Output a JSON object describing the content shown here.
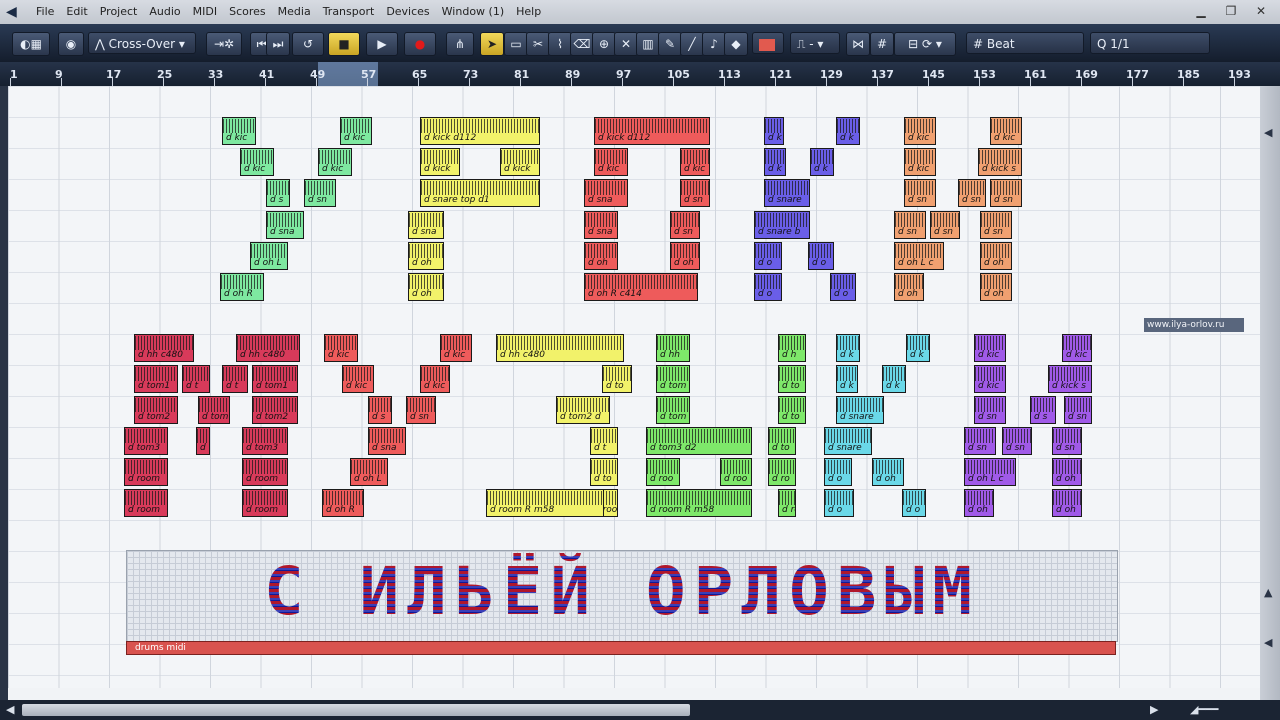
{
  "menubar": {
    "items": [
      "File",
      "Edit",
      "Project",
      "Audio",
      "MIDI",
      "Scores",
      "Media",
      "Transport",
      "Devices",
      "Window (1)",
      "Help"
    ]
  },
  "toolbar": {
    "automation_mode": "Cross-Over",
    "color_swatch": "#e15a4f",
    "snap_type": "Beat",
    "quantize": "1/1"
  },
  "ruler": {
    "ticks": [
      "1",
      "9",
      "17",
      "25",
      "33",
      "41",
      "49",
      "57",
      "65",
      "73",
      "81",
      "89",
      "97",
      "105",
      "113",
      "121",
      "129",
      "137",
      "145",
      "153",
      "161",
      "169",
      "177",
      "185",
      "193"
    ]
  },
  "watermark": "www.ilya-orlov.ru",
  "banner": {
    "title": "С ИЛЬЁЙ ОРЛОВЫМ",
    "track_label": "drums midi"
  },
  "events": [
    {
      "label": "d kic",
      "color": "#7ee8a0"
    },
    {
      "label": "d kic",
      "color": "#7ee8a0"
    },
    {
      "label": "d kic",
      "color": "#7ee8a0"
    },
    {
      "label": "d kic",
      "color": "#7ee8a0"
    },
    {
      "label": "d s",
      "color": "#7ee8a0"
    },
    {
      "label": "d sn",
      "color": "#7ee8a0"
    },
    {
      "label": "d sna",
      "color": "#7ee8a0"
    },
    {
      "label": "d oh L",
      "color": "#7ee8a0"
    },
    {
      "label": "d oh R",
      "color": "#7ee8a0"
    },
    {
      "label": "d kick d112",
      "color": "#f2f26a"
    },
    {
      "label": "d kick",
      "color": "#f2f26a"
    },
    {
      "label": "d kick",
      "color": "#f2f26a"
    },
    {
      "label": "d snare top d1",
      "color": "#f2f26a"
    },
    {
      "label": "d sna",
      "color": "#f2f26a"
    },
    {
      "label": "d oh",
      "color": "#f2f26a"
    },
    {
      "label": "d oh",
      "color": "#f2f26a"
    },
    {
      "label": "d kick d112",
      "color": "#ee5b5b"
    },
    {
      "label": "d kic",
      "color": "#ee5b5b"
    },
    {
      "label": "d kic",
      "color": "#ee5b5b"
    },
    {
      "label": "d sna",
      "color": "#ee5b5b"
    },
    {
      "label": "d sn",
      "color": "#ee5b5b"
    },
    {
      "label": "d sna",
      "color": "#ee5b5b"
    },
    {
      "label": "d sn",
      "color": "#ee5b5b"
    },
    {
      "label": "d oh",
      "color": "#ee5b5b"
    },
    {
      "label": "d oh",
      "color": "#ee5b5b"
    },
    {
      "label": "d oh R c414",
      "color": "#ee5b5b"
    },
    {
      "label": "d k",
      "color": "#6a5ee8"
    },
    {
      "label": "d k",
      "color": "#6a5ee8"
    },
    {
      "label": "d k",
      "color": "#6a5ee8"
    },
    {
      "label": "d k",
      "color": "#6a5ee8"
    },
    {
      "label": "d snare",
      "color": "#6a5ee8"
    },
    {
      "label": "d snare b",
      "color": "#6a5ee8"
    },
    {
      "label": "d o",
      "color": "#6a5ee8"
    },
    {
      "label": "d o",
      "color": "#6a5ee8"
    },
    {
      "label": "d o",
      "color": "#6a5ee8"
    },
    {
      "label": "d o",
      "color": "#6a5ee8"
    },
    {
      "label": "d kic",
      "color": "#f0a070"
    },
    {
      "label": "d kic",
      "color": "#f0a070"
    },
    {
      "label": "d kic",
      "color": "#f0a070"
    },
    {
      "label": "d kick s",
      "color": "#f0a070"
    },
    {
      "label": "d sn",
      "color": "#f0a070"
    },
    {
      "label": "d sn",
      "color": "#f0a070"
    },
    {
      "label": "d sn",
      "color": "#f0a070"
    },
    {
      "label": "d sn",
      "color": "#f0a070"
    },
    {
      "label": "d sn",
      "color": "#f0a070"
    },
    {
      "label": "d sn",
      "color": "#f0a070"
    },
    {
      "label": "d oh L c",
      "color": "#f0a070"
    },
    {
      "label": "d oh",
      "color": "#f0a070"
    },
    {
      "label": "d oh",
      "color": "#f0a070"
    },
    {
      "label": "d oh",
      "color": "#f0a070"
    },
    {
      "label": "d hh c480",
      "color": "#d83a5a"
    },
    {
      "label": "d hh c480",
      "color": "#d83a5a"
    },
    {
      "label": "d tom1",
      "color": "#d83a5a"
    },
    {
      "label": "d t",
      "color": "#d83a5a"
    },
    {
      "label": "d t",
      "color": "#d83a5a"
    },
    {
      "label": "d tom1",
      "color": "#d83a5a"
    },
    {
      "label": "d tom2",
      "color": "#d83a5a"
    },
    {
      "label": "d tom",
      "color": "#d83a5a"
    },
    {
      "label": "d tom2",
      "color": "#d83a5a"
    },
    {
      "label": "d tom3",
      "color": "#d83a5a"
    },
    {
      "label": "d",
      "color": "#d83a5a"
    },
    {
      "label": "d tom3",
      "color": "#d83a5a"
    },
    {
      "label": "d room",
      "color": "#d83a5a"
    },
    {
      "label": "d room",
      "color": "#d83a5a"
    },
    {
      "label": "d room",
      "color": "#d83a5a"
    },
    {
      "label": "d room",
      "color": "#d83a5a"
    },
    {
      "label": "d kic",
      "color": "#ee5b5b"
    },
    {
      "label": "d kic",
      "color": "#ee5b5b"
    },
    {
      "label": "d kic",
      "color": "#ee5b5b"
    },
    {
      "label": "d kic",
      "color": "#ee5b5b"
    },
    {
      "label": "d s",
      "color": "#ee5b5b"
    },
    {
      "label": "d sn",
      "color": "#ee5b5b"
    },
    {
      "label": "d sna",
      "color": "#ee5b5b"
    },
    {
      "label": "d oh L",
      "color": "#ee5b5b"
    },
    {
      "label": "d oh R",
      "color": "#ee5b5b"
    },
    {
      "label": "d hh c480",
      "color": "#f2f26a"
    },
    {
      "label": "d to",
      "color": "#f2f26a"
    },
    {
      "label": "d tom2 d",
      "color": "#f2f26a"
    },
    {
      "label": "d t",
      "color": "#f2f26a"
    },
    {
      "label": "d to",
      "color": "#f2f26a"
    },
    {
      "label": "d roo",
      "color": "#f2f26a"
    },
    {
      "label": "d room R m58",
      "color": "#f2f26a"
    },
    {
      "label": "d hh",
      "color": "#7ee86a"
    },
    {
      "label": "d tom",
      "color": "#7ee86a"
    },
    {
      "label": "d tom",
      "color": "#7ee86a"
    },
    {
      "label": "d tom3 d2",
      "color": "#7ee86a"
    },
    {
      "label": "d roo",
      "color": "#7ee86a"
    },
    {
      "label": "d roo",
      "color": "#7ee86a"
    },
    {
      "label": "d room R m58",
      "color": "#7ee86a"
    },
    {
      "label": "d h",
      "color": "#7ee86a"
    },
    {
      "label": "d to",
      "color": "#7ee86a"
    },
    {
      "label": "d to",
      "color": "#7ee86a"
    },
    {
      "label": "d to",
      "color": "#7ee86a"
    },
    {
      "label": "d ro",
      "color": "#7ee86a"
    },
    {
      "label": "d ro",
      "color": "#7ee86a"
    },
    {
      "label": "d k",
      "color": "#6ad8e8"
    },
    {
      "label": "d k",
      "color": "#6ad8e8"
    },
    {
      "label": "d k",
      "color": "#6ad8e8"
    },
    {
      "label": "d k",
      "color": "#6ad8e8"
    },
    {
      "label": "d snare",
      "color": "#6ad8e8"
    },
    {
      "label": "d snare",
      "color": "#6ad8e8"
    },
    {
      "label": "d o",
      "color": "#6ad8e8"
    },
    {
      "label": "d oh",
      "color": "#6ad8e8"
    },
    {
      "label": "d o",
      "color": "#6ad8e8"
    },
    {
      "label": "d o",
      "color": "#6ad8e8"
    },
    {
      "label": "d kic",
      "color": "#a05ae8"
    },
    {
      "label": "d kic",
      "color": "#a05ae8"
    },
    {
      "label": "d kic",
      "color": "#a05ae8"
    },
    {
      "label": "d kick s",
      "color": "#a05ae8"
    },
    {
      "label": "d sn",
      "color": "#a05ae8"
    },
    {
      "label": "d s",
      "color": "#a05ae8"
    },
    {
      "label": "d sn",
      "color": "#a05ae8"
    },
    {
      "label": "d sn",
      "color": "#a05ae8"
    },
    {
      "label": "d sn",
      "color": "#a05ae8"
    },
    {
      "label": "d sn",
      "color": "#a05ae8"
    },
    {
      "label": "d oh L c",
      "color": "#a05ae8"
    },
    {
      "label": "d oh",
      "color": "#a05ae8"
    },
    {
      "label": "d oh",
      "color": "#a05ae8"
    },
    {
      "label": "d oh",
      "color": "#a05ae8"
    }
  ]
}
